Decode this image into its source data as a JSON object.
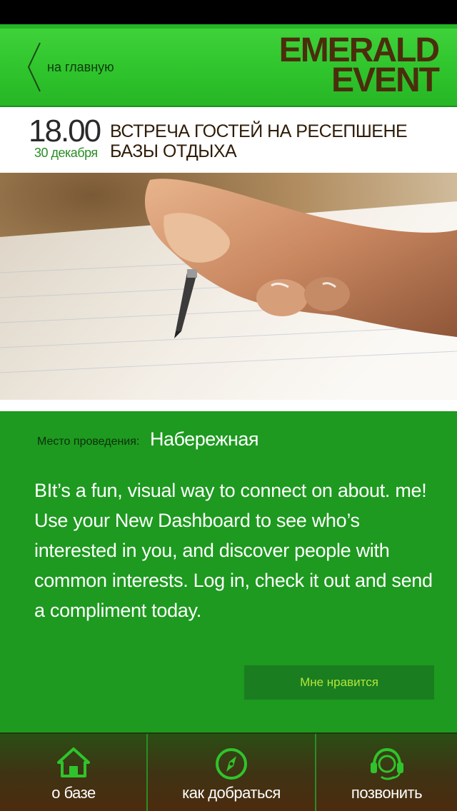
{
  "header": {
    "back_label": "на главную",
    "brand_line1": "EMERALD",
    "brand_line2": "EVENT"
  },
  "event": {
    "time": "18.00",
    "date": "30 декабря",
    "title": "ВСТРЕЧА ГОСТЕЙ НА РЕСЕПШЕНЕ БАЗЫ ОТДЫХА"
  },
  "details": {
    "venue_label": "Место проведения:",
    "venue_value": "Набережная",
    "description": "BIt’s a fun, visual way to connect on about. me! Use your New Dashboard to see who’s interested in you, and discover people with common interests. Log in, check it out and send a compliment today.",
    "like_label": "Мне нравится"
  },
  "tabs": [
    {
      "label": "о базе",
      "icon": "home-icon"
    },
    {
      "label": "как добраться",
      "icon": "compass-icon"
    },
    {
      "label": "позвонить",
      "icon": "headset-icon"
    }
  ],
  "colors": {
    "accent_green": "#1d9a1f",
    "header_green": "#2fc42c",
    "brand_brown": "#4a2e0c",
    "tab_icon_green": "#2fc42c"
  }
}
